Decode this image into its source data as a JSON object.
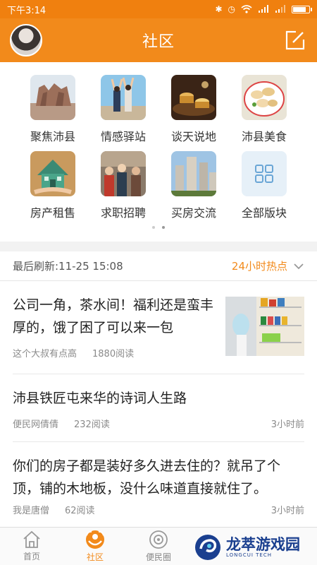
{
  "status": {
    "time": "下午3:14",
    "battery_level": 0.85
  },
  "header": {
    "title": "社区",
    "avatar_icon": "user-avatar",
    "edit_icon": "compose-icon"
  },
  "categories": [
    {
      "label": "聚焦沛县",
      "icon": "stone-statue-image"
    },
    {
      "label": "情感驿站",
      "icon": "couple-image"
    },
    {
      "label": "谈天说地",
      "icon": "teacups-image"
    },
    {
      "label": "沛县美食",
      "icon": "dumplings-image"
    },
    {
      "label": "房产租售",
      "icon": "house-image"
    },
    {
      "label": "求职招聘",
      "icon": "crowd-image"
    },
    {
      "label": "买房交流",
      "icon": "buildings-image"
    },
    {
      "label": "全部版块",
      "icon": "grid-icon"
    }
  ],
  "pager": {
    "pages": 2,
    "active": 1
  },
  "refresh": {
    "text": "最后刷新:11-25 15:08",
    "hot_label": "24小时热点"
  },
  "posts": [
    {
      "title": "公司一角，茶水间！福利还是蛮丰厚的，饿了困了可以来一包",
      "author": "这个大叔有点高",
      "reads": "1880阅读",
      "time": ""
    },
    {
      "title": "沛县铁匠屯来华的诗词人生路",
      "author": "便民网倩倩",
      "reads": "232阅读",
      "time": "3小时前"
    },
    {
      "title": "你们的房子都是装好多久进去住的？就吊了个顶，铺的木地板，没什么味道直接就住了。",
      "author": "我是唐僧",
      "reads": "62阅读",
      "time": "3小时前"
    }
  ],
  "tabs": [
    {
      "label": "首页",
      "icon": "home-icon"
    },
    {
      "label": "社区",
      "icon": "community-icon"
    },
    {
      "label": "便民圈",
      "icon": "circle-icon"
    }
  ],
  "watermark": {
    "text": "龙萃游戏园",
    "sub": "LONGCUI TECH"
  },
  "colors": {
    "brand": "#f28a1b",
    "status_bar": "#f0800f"
  }
}
